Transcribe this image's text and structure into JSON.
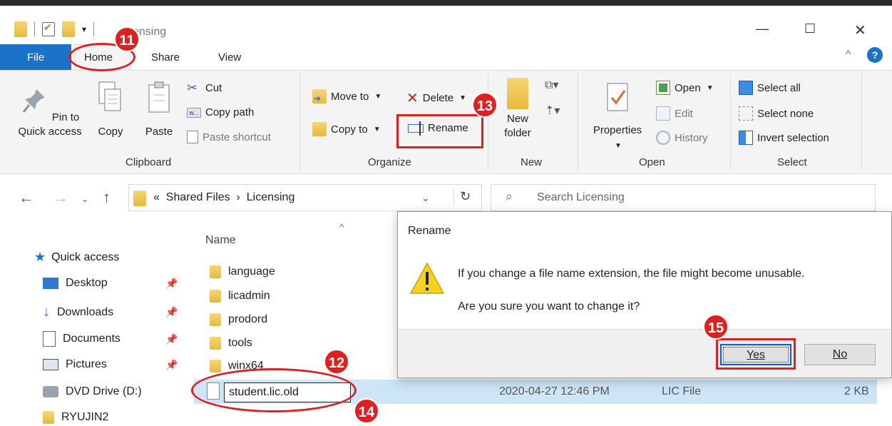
{
  "window": {
    "title": "Licensing",
    "title_visible_fragment": "ensing"
  },
  "tabs": {
    "file": "File",
    "home": "Home",
    "share": "Share",
    "view": "View"
  },
  "ribbon": {
    "clipboard": {
      "pin_label": "Pin to Quick access",
      "copy_label": "Copy",
      "paste_label": "Paste",
      "cut_label": "Cut",
      "copy_path_label": "Copy path",
      "paste_shortcut_label": "Paste shortcut",
      "group_label": "Clipboard"
    },
    "organize": {
      "move_to_label": "Move to",
      "copy_to_label": "Copy to",
      "delete_label": "Delete",
      "rename_label": "Rename",
      "group_label": "Organize"
    },
    "new": {
      "new_folder_label": "New folder",
      "group_label": "New"
    },
    "open": {
      "properties_label": "Properties",
      "open_label": "Open",
      "edit_label": "Edit",
      "history_label": "History",
      "group_label": "Open"
    },
    "select": {
      "select_all_label": "Select all",
      "select_none_label": "Select none",
      "invert_label": "Invert selection",
      "group_label": "Select"
    }
  },
  "address": {
    "prefix": "«",
    "crumb1": "Shared Files",
    "sep": "›",
    "crumb2": "Licensing",
    "search_placeholder": "Search Licensing"
  },
  "sidebar": {
    "quick_access": "Quick access",
    "items": [
      {
        "label": "Desktop"
      },
      {
        "label": "Downloads"
      },
      {
        "label": "Documents"
      },
      {
        "label": "Pictures"
      },
      {
        "label": "DVD Drive (D:)"
      },
      {
        "label": "RYUJIN2"
      }
    ]
  },
  "filelist": {
    "col_name": "Name",
    "folders": [
      "language",
      "licadmin",
      "prodord",
      "tools",
      "winx64"
    ],
    "rename_value": "student.lic.old",
    "selected_date": "2020-04-27 12:46 PM",
    "selected_type": "LIC File",
    "selected_size": "2 KB"
  },
  "dialog": {
    "title": "Rename",
    "message1": "If you change a file name extension, the file might become unusable.",
    "message2": "Are you sure you want to change it?",
    "yes_label": "Yes",
    "no_label": "No"
  },
  "annotations": {
    "b11": "11",
    "b12": "12",
    "b13": "13",
    "b14": "14",
    "b15": "15"
  },
  "colors": {
    "accent": "#1a73c8",
    "annotation": "#e02020",
    "selection": "#cde6f7"
  }
}
